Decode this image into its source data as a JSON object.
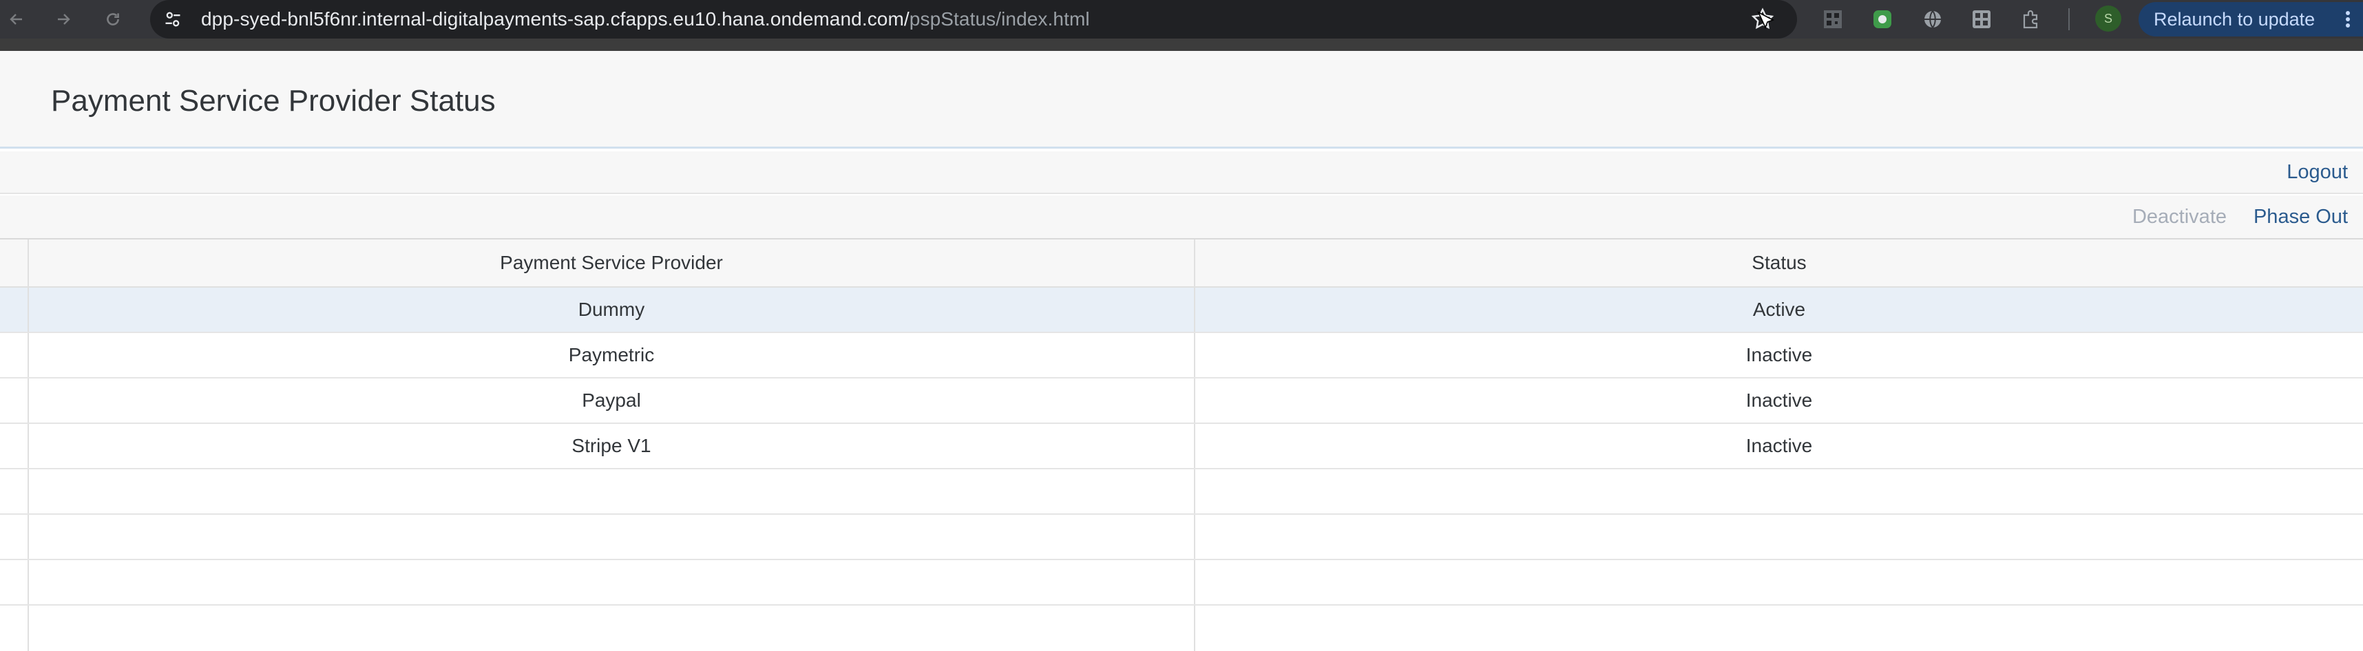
{
  "browser": {
    "url_host": "dpp-syed-bnl5f6nr.internal-digitalpayments-sap.cfapps.eu10.hana.ondemand.com/",
    "url_path": "pspStatus/index.html",
    "relaunch_label": "Relaunch to update",
    "profile_initial": "S",
    "extensions": [
      "qr-extension-icon",
      "green-extension-icon",
      "globe-extension-icon",
      "qr-scanner-icon",
      "puzzle-extensions-icon"
    ]
  },
  "app": {
    "title": "Payment Service Provider Status"
  },
  "toolbar": {
    "logout_label": "Logout",
    "deactivate_label": "Deactivate",
    "phase_out_label": "Phase Out"
  },
  "table": {
    "columns": [
      "Payment Service Provider",
      "Status"
    ],
    "rows": [
      {
        "provider": "Dummy",
        "status": "Active",
        "selected": true
      },
      {
        "provider": "Paymetric",
        "status": "Inactive",
        "selected": false
      },
      {
        "provider": "Paypal",
        "status": "Inactive",
        "selected": false
      },
      {
        "provider": "Stripe V1",
        "status": "Inactive",
        "selected": false
      }
    ],
    "empty_rows": 4
  },
  "colors": {
    "link": "#2b5b8e",
    "disabled": "#a6adb8",
    "selected_row": "#e8eff7",
    "header_bg": "#f7f7f7"
  }
}
